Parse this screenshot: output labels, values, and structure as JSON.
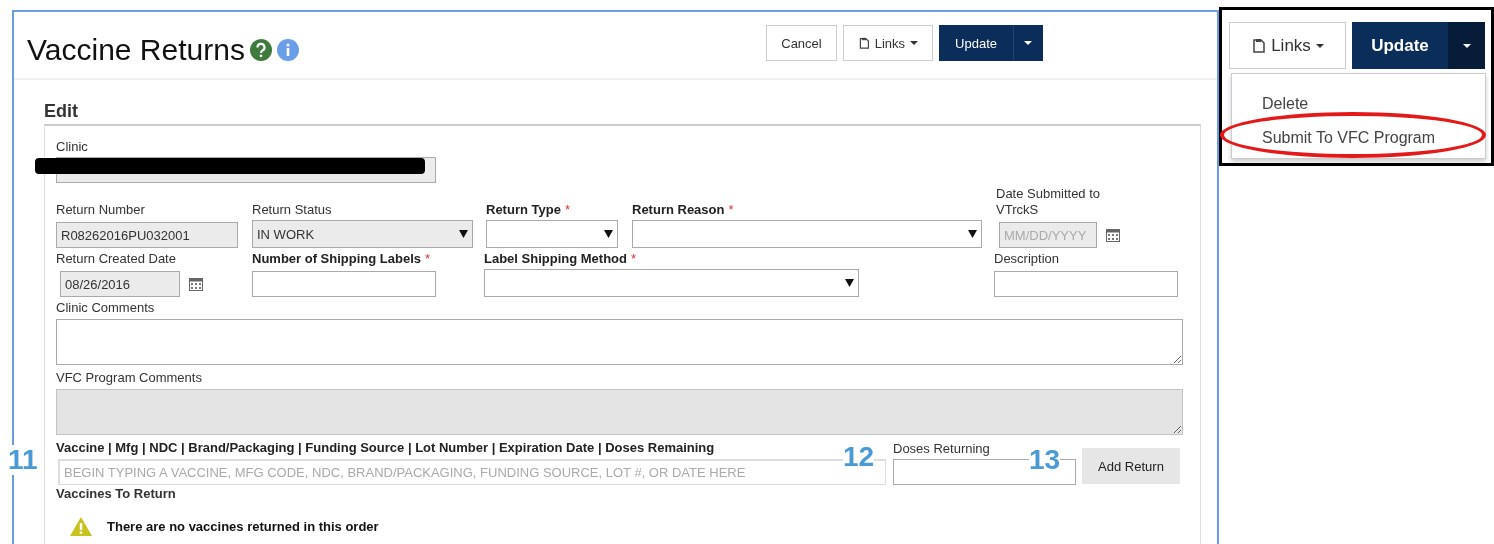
{
  "page": {
    "title": "Vaccine Returns"
  },
  "header_buttons": [
    {
      "kind": "plain",
      "label": "Cancel"
    },
    {
      "kind": "links",
      "label": "Links"
    },
    {
      "kind": "split",
      "label": "Update"
    }
  ],
  "section": {
    "title": "Edit"
  },
  "clinic": {
    "label": "Clinic",
    "redacted": true
  },
  "form_rows": [
    [
      {
        "kind": "text",
        "label": "Return Number",
        "value": "R08262016PU032001",
        "disabled": true,
        "required": false
      },
      {
        "kind": "select",
        "label": "Return Status",
        "value": "IN WORK",
        "disabled": true,
        "required": false
      },
      {
        "kind": "select",
        "label": "Return Type",
        "required": true,
        "mark": "*",
        "disabled": false
      },
      {
        "kind": "select",
        "label": "Return Reason",
        "required": true,
        "mark": "*",
        "disabled": false
      },
      {
        "kind": "date",
        "label": "Date Submitted to VTrckS",
        "placeholder": "MM/DD/YYYY",
        "disabled": true,
        "required": false
      }
    ],
    [
      {
        "kind": "date",
        "label": "Return Created Date",
        "value": "08/26/2016",
        "disabled": true,
        "required": false
      },
      {
        "kind": "text",
        "label": "Number of Shipping Labels",
        "required": true,
        "mark": "*",
        "disabled": false
      },
      {
        "kind": "select",
        "label": "Label Shipping Method",
        "required": true,
        "mark": "*",
        "disabled": false
      },
      {
        "kind": "text",
        "label": "Description",
        "required": false,
        "disabled": false
      }
    ]
  ],
  "comments": [
    {
      "label": "Clinic Comments",
      "disabled": false
    },
    {
      "label": "VFC Program Comments",
      "disabled": true
    }
  ],
  "vaccine_search": {
    "label": "Vaccine | Mfg | NDC | Brand/Packaging | Funding Source | Lot Number | Expiration Date | Doses Remaining",
    "placeholder": "BEGIN TYPING A VACCINE, MFG CODE, NDC, BRAND/PACKAGING, FUNDING SOURCE, LOT #, OR DATE HERE"
  },
  "doses": {
    "label": "Doses Returning"
  },
  "add_button": {
    "label": "Add Return"
  },
  "returns": {
    "title": "Vaccines To Return",
    "notice": "There are no vaccines returned in this order"
  },
  "callouts": [
    "11",
    "12",
    "13"
  ],
  "inset": {
    "buttons": [
      {
        "kind": "links",
        "label": "Links"
      },
      {
        "kind": "split",
        "label": "Update"
      }
    ],
    "menu": [
      {
        "label": "Delete",
        "highlighted": false
      },
      {
        "label": "Submit To VFC Program",
        "highlighted": true
      }
    ]
  }
}
